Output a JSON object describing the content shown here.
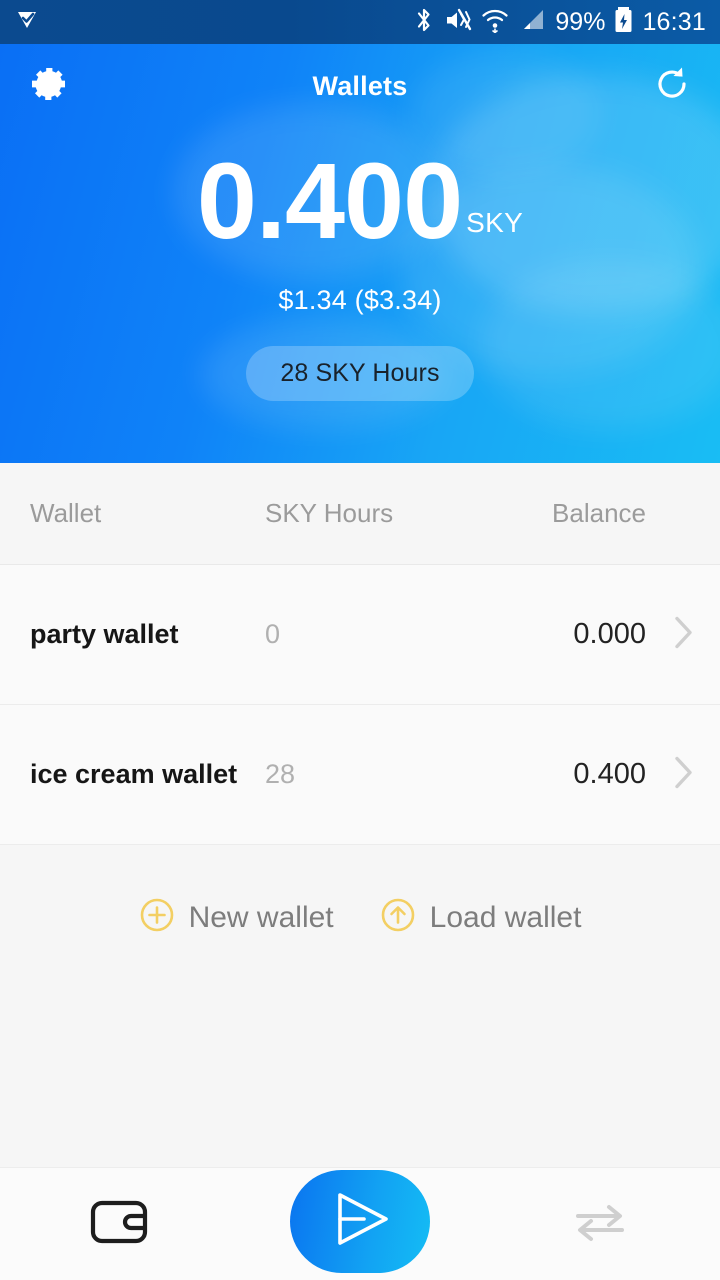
{
  "statusbar": {
    "notification_icon": "notification-check-icon",
    "icons": [
      "bluetooth-icon",
      "vibrate-mute-icon",
      "wifi-icon",
      "cell-signal-icon",
      "battery-charging-icon"
    ],
    "battery_percent": "99%",
    "time": "16:31"
  },
  "appbar": {
    "title": "Wallets",
    "settings_icon": "gear-icon",
    "refresh_icon": "refresh-icon"
  },
  "hero": {
    "balance": "0.400",
    "unit": "SKY",
    "fiat": "$1.34 ($3.34)",
    "hours_pill": "28 SKY Hours"
  },
  "table": {
    "headers": {
      "wallet": "Wallet",
      "hours": "SKY Hours",
      "balance": "Balance"
    },
    "rows": [
      {
        "name": "party wallet",
        "hours": "0",
        "balance": "0.000",
        "chevron": "chevron-right-icon"
      },
      {
        "name": "ice cream wallet",
        "hours": "28",
        "balance": "0.400",
        "chevron": "chevron-right-icon"
      }
    ]
  },
  "actions": {
    "new_wallet": {
      "label": "New wallet",
      "icon": "plus-circle-icon"
    },
    "load_wallet": {
      "label": "Load wallet",
      "icon": "arrow-up-circle-icon"
    }
  },
  "bottomnav": {
    "wallet_icon": "wallet-icon",
    "send_icon": "send-plane-icon",
    "exchange_icon": "exchange-arrows-icon"
  },
  "colors": {
    "hero_start": "#0a6ff5",
    "hero_end": "#19bdf4",
    "statusbar": "#0b4a8f",
    "accent_yellow": "#f3cf63",
    "list_bg": "#f6f6f6",
    "row_bg": "#fafafa",
    "header_text": "#9b9b9b"
  }
}
